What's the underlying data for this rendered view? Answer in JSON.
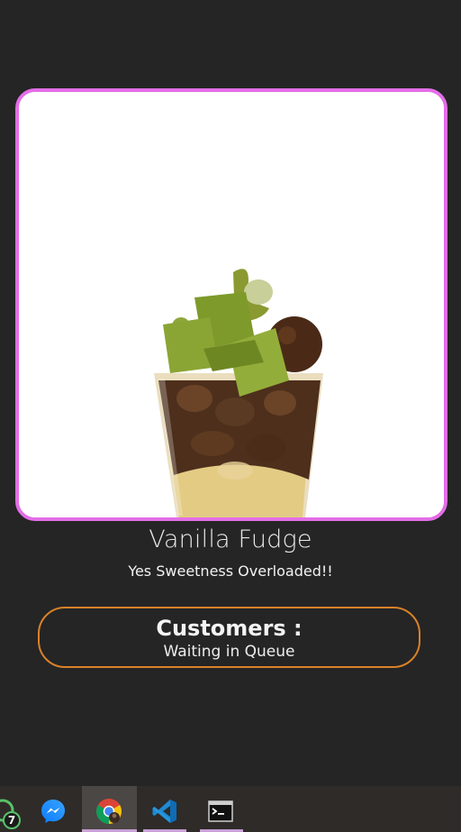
{
  "product": {
    "name": "Vanilla Fudge",
    "tagline": "Yes Sweetness Overloaded!!"
  },
  "customers": {
    "title": "Customers :",
    "status": "Waiting in Queue"
  },
  "taskbar": {
    "badge_count": "7",
    "items": [
      {
        "name": "messenger",
        "active": false
      },
      {
        "name": "chrome",
        "active": true
      },
      {
        "name": "vscode",
        "active": false
      },
      {
        "name": "terminal",
        "active": false
      }
    ]
  },
  "colors": {
    "background": "#252525",
    "image_border": "#e36ee6",
    "customers_border": "#d9822a",
    "taskbar": "#2e2b28"
  }
}
